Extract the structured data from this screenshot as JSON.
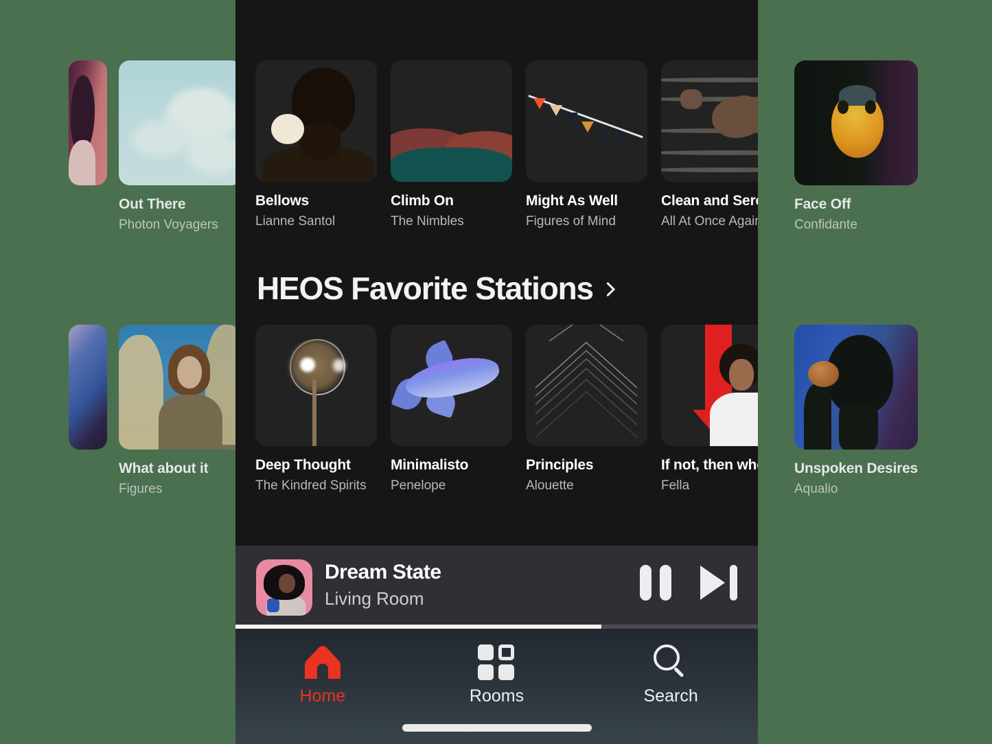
{
  "app": {
    "background_color": "#4a7050",
    "screen_background": "#161616",
    "accent_color": "#ea3323"
  },
  "sections": [
    {
      "id": "top-row",
      "heading": null,
      "cards": [
        {
          "title": "Out There",
          "artist": "Photon Voyagers",
          "art": "a-clouds"
        },
        {
          "title": "Bellows",
          "artist": "Lianne Santol",
          "art": "a-portrait"
        },
        {
          "title": "Climb On",
          "artist": "The Nimbles",
          "art": "a-sunset"
        },
        {
          "title": "Might As Well",
          "artist": "Figures of Mind",
          "art": "a-flags"
        },
        {
          "title": "Clean and Serene",
          "artist": "All At Once Again",
          "art": "a-water"
        },
        {
          "title": "Face Off",
          "artist": "Confidante",
          "art": "a-bird"
        }
      ]
    },
    {
      "id": "heos-favorite-stations",
      "heading": "HEOS Favorite Stations",
      "heading_chevron": "chevron-right-icon",
      "cards": [
        {
          "title": "What about it",
          "artist": "Figures",
          "art": "a-field"
        },
        {
          "title": "Deep Thought",
          "artist": "The Kindred Spirits",
          "art": "a-palm"
        },
        {
          "title": "Minimalisto",
          "artist": "Penelope",
          "art": "a-shark"
        },
        {
          "title": "Principles",
          "artist": "Alouette",
          "art": "a-chev"
        },
        {
          "title": "If not, then when?",
          "artist": "Fella",
          "art": "a-arrow"
        },
        {
          "title": "Unspoken Desires",
          "artist": "Aqualio",
          "art": "a-silhouette"
        }
      ]
    }
  ],
  "edge_peeks": {
    "row1_left": {
      "art": "a-pink"
    },
    "row2_left": {
      "art": "a-bluepurple"
    }
  },
  "now_playing": {
    "title": "Dream State",
    "room": "Living Room",
    "art": "a-dream",
    "progress_percent": 70,
    "pause_button_label": "Pause",
    "next_button_label": "Next"
  },
  "tab_bar": {
    "items": [
      {
        "label": "Home",
        "icon": "home-icon",
        "active": true
      },
      {
        "label": "Rooms",
        "icon": "grid-icon",
        "active": false
      },
      {
        "label": "Search",
        "icon": "search-icon",
        "active": false
      }
    ]
  }
}
